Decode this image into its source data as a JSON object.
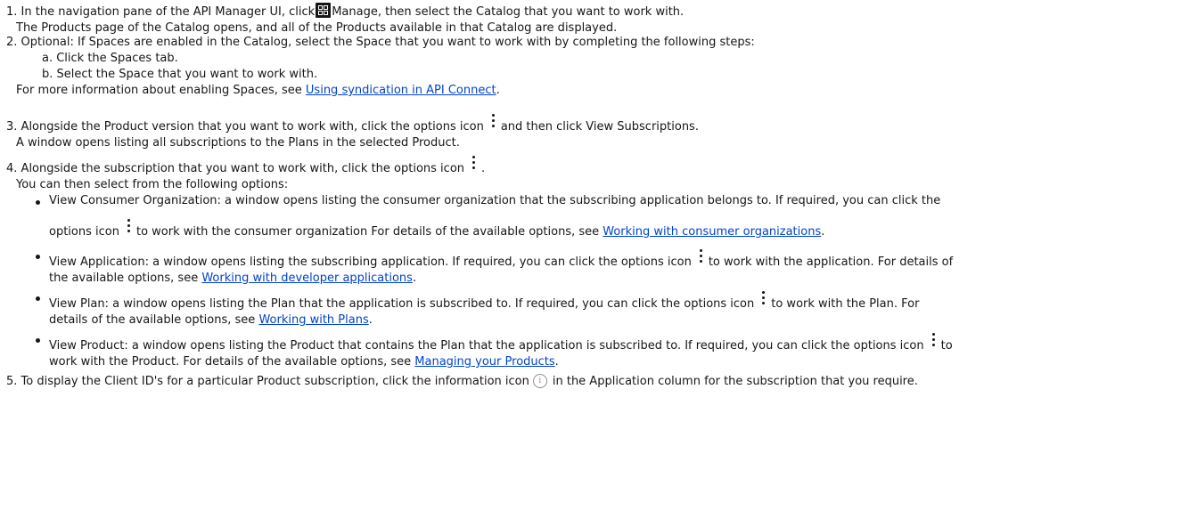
{
  "steps": {
    "s1": {
      "num": "1.",
      "pre": "In the navigation pane of the API Manager UI, click",
      "post": "Manage, then select the Catalog that you want to work with.",
      "result": "The Products page of the Catalog opens, and all of the Products available in that Catalog are displayed.",
      "icon": "manage-icon"
    },
    "s2": {
      "num": "2.",
      "text": "Optional: If Spaces are enabled in the Catalog, select the Space that you want to work with by completing the following steps:",
      "sub_a": "a. Click the Spaces tab.",
      "sub_b": "b. Select the Space that you want to work with.",
      "more_pre": "For more information about enabling Spaces, see",
      "more_link": "Using syndication in API Connect",
      "more_post": "."
    },
    "s3": {
      "num": "3.",
      "pre": "Alongside the Product version that you want to work with, click the options icon",
      "post": "and then click View Subscriptions.",
      "result": "A window opens listing all subscriptions to the Plans in the selected Product."
    },
    "s4": {
      "num": "4.",
      "pre": "Alongside the subscription that you want to work with, click the options icon",
      "post": ".",
      "result": "You can then select from the following options:",
      "options": {
        "consumer_org": {
          "line1": "View Consumer Organization: a window opens listing the consumer organization that the subscribing application belongs to. If required, you can click the",
          "line2_pre": "options icon",
          "line2_mid": "to work with the consumer organization For details of the available options, see",
          "link": "Working with consumer organizations",
          "post": "."
        },
        "application": {
          "line1_pre": "View Application: a window opens listing the subscribing application. If required, you can click the options icon",
          "line1_post": "to work with the application. For details of",
          "line2_pre": "the available options, see",
          "link": "Working with developer applications",
          "post": "."
        },
        "plan": {
          "line1_pre": "View Plan: a window opens listing the Plan that the application is subscribed to. If required, you can click the options icon",
          "line1_post": "to work with the Plan. For",
          "line2_pre": "details of the available options, see",
          "link": "Working with Plans",
          "post": "."
        },
        "product": {
          "line1_pre": "View Product: a window opens listing the Product that contains the Plan that the application is subscribed to. If required, you can click the options icon",
          "line1_post": "to",
          "line2_pre": "work with the Product. For details of the available options, see",
          "link": "Managing your Products",
          "post": "."
        }
      }
    },
    "s5": {
      "num": "5.",
      "pre": "To display the Client ID's for a particular Product subscription, click the information icon",
      "post": "in the Application column for the subscription that you require.",
      "icon_glyph": "i"
    }
  },
  "icons": {
    "kebab": "options-icon",
    "info": "information-icon"
  },
  "colors": {
    "text": "#161616",
    "link": "#0f62fe"
  }
}
